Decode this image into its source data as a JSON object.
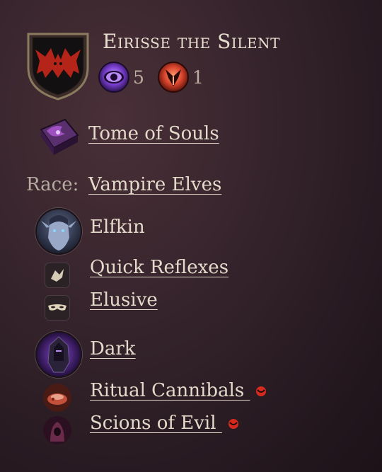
{
  "hero": {
    "name": "Eirisse the Silent",
    "stats": [
      {
        "icon": "eye-icon",
        "value": "5"
      },
      {
        "icon": "order-icon",
        "value": "1"
      }
    ]
  },
  "tome": {
    "label": "Tome of Souls",
    "icon": "tome-icon"
  },
  "race": {
    "label": "Race:",
    "value": "Vampire Elves"
  },
  "form": {
    "label": "Elfkin",
    "icon": "elf-portrait-icon"
  },
  "form_traits": [
    {
      "label": "Quick Reflexes",
      "icon": "hand-icon"
    },
    {
      "label": "Elusive",
      "icon": "mask-icon"
    }
  ],
  "culture": {
    "label": "Dark",
    "icon": "dark-helmet-icon"
  },
  "culture_traits": [
    {
      "label": "Ritual Cannibals",
      "icon": "meat-icon",
      "marker": "evil-marker-icon"
    },
    {
      "label": "Scions of Evil",
      "icon": "hooded-figure-icon",
      "marker": "evil-marker-icon"
    }
  ],
  "colors": {
    "background": "#2e1f26",
    "text": "#e3dacb",
    "evil_red": "#d62a1e",
    "eye_purple": "#8a4fd8",
    "order_red": "#d8432c"
  }
}
